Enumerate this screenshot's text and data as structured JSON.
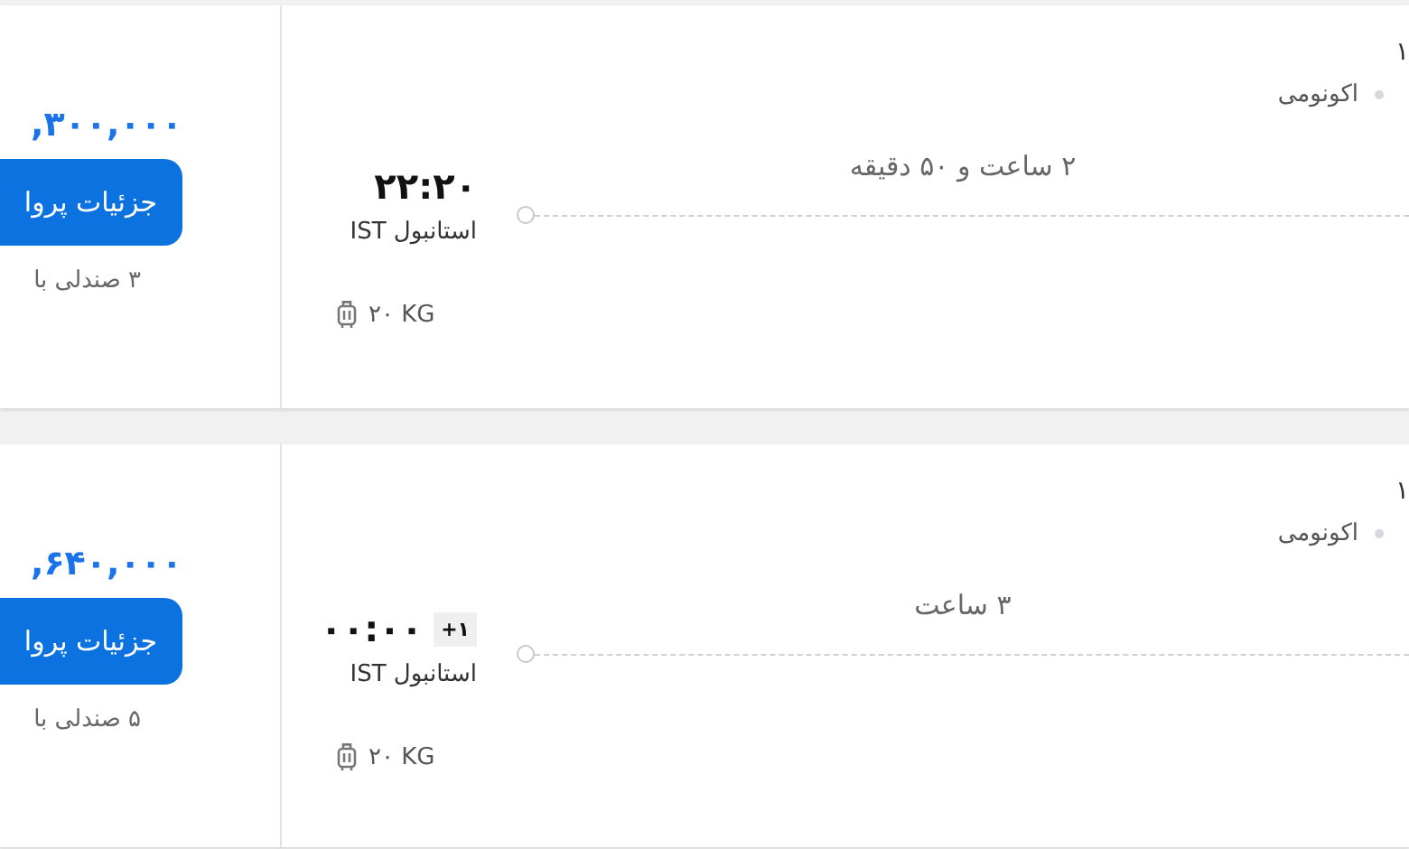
{
  "flights": [
    {
      "top_text": "۱",
      "cabin_class": "اکونومی",
      "price": ",۳۰۰,۰۰۰",
      "details_button": "جزئیات پروا",
      "seats_left": "۳ صندلی با",
      "arrival_time": "۲۲:۲۰",
      "arrival_airport": "استانبول IST",
      "duration": "۲ ساعت و ۵۰ دقیقه",
      "baggage": "۲۰ KG"
    },
    {
      "top_text": "۱",
      "cabin_class": "اکونومی",
      "price": ",۶۴۰,۰۰۰",
      "details_button": "جزئیات پروا",
      "seats_left": "۵ صندلی با",
      "arrival_time": "۰۰:۰۰",
      "day_offset": "+۱",
      "arrival_airport": "استانبول IST",
      "duration": "۳ ساعت",
      "baggage": "۲۰ KG"
    }
  ]
}
